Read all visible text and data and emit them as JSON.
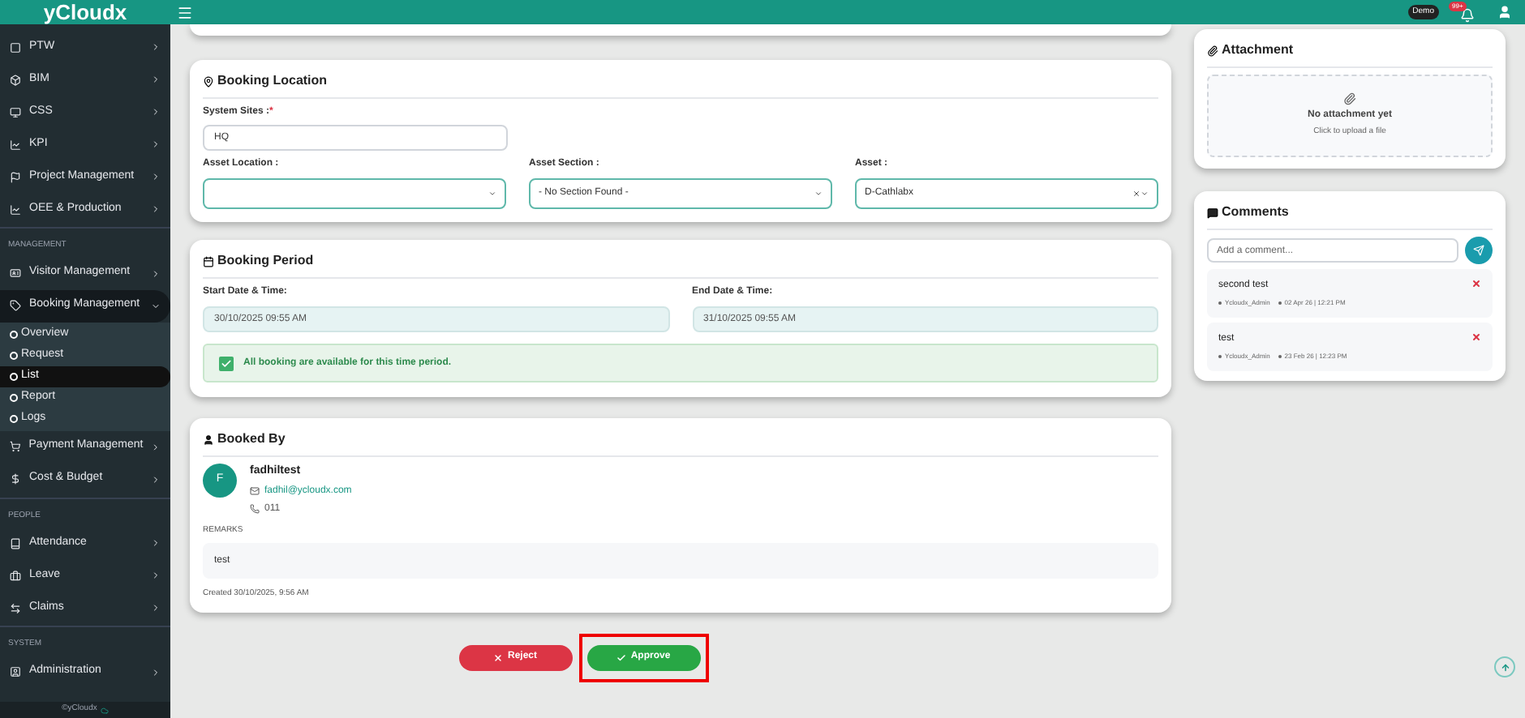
{
  "brand": "yCloudx",
  "topbar": {
    "badge": "Demo",
    "notifications": "99+"
  },
  "sidebar": {
    "entries": [
      {
        "kind": "item",
        "label": "PTW",
        "expanded": false
      },
      {
        "kind": "item",
        "label": "BIM",
        "expanded": false
      },
      {
        "kind": "item",
        "label": "CSS",
        "expanded": false
      },
      {
        "kind": "item",
        "label": "KPI",
        "expanded": false
      },
      {
        "kind": "item",
        "label": "Project Management",
        "expanded": false
      },
      {
        "kind": "item",
        "label": "OEE & Production",
        "expanded": false
      },
      {
        "kind": "header",
        "label": "MANAGEMENT"
      },
      {
        "kind": "item",
        "label": "Visitor Management",
        "expanded": false
      },
      {
        "kind": "item",
        "label": "Booking Management",
        "expanded": true,
        "children": [
          {
            "label": "Overview",
            "selected": false
          },
          {
            "label": "Request",
            "selected": false
          },
          {
            "label": "List",
            "selected": true
          },
          {
            "label": "Report",
            "selected": false
          },
          {
            "label": "Logs",
            "selected": false
          }
        ]
      },
      {
        "kind": "item",
        "label": "Payment Management",
        "expanded": false
      },
      {
        "kind": "item",
        "label": "Cost & Budget",
        "expanded": false
      },
      {
        "kind": "header",
        "label": "PEOPLE"
      },
      {
        "kind": "item",
        "label": "Attendance",
        "expanded": false
      },
      {
        "kind": "item",
        "label": "Leave",
        "expanded": false
      },
      {
        "kind": "item",
        "label": "Claims",
        "expanded": false
      },
      {
        "kind": "header",
        "label": "SYSTEM"
      },
      {
        "kind": "item",
        "label": "Administration",
        "expanded": false
      }
    ],
    "footer": "©yCloudx"
  },
  "booking_location": {
    "title": "Booking Location",
    "system_sites_label": "System Sites :",
    "required_mark": "*",
    "system_sites_value": "HQ",
    "selects": [
      {
        "label": "Asset Location :",
        "clearable": false
      },
      {
        "label": "Asset Section :",
        "value": "- No Section Found -",
        "clearable": false
      },
      {
        "label": "Asset :",
        "value": "D-Cathlabx",
        "clearable": true
      }
    ]
  },
  "booking_period": {
    "title": "Booking Period",
    "fields": [
      {
        "label": "Start Date & Time:",
        "value": "30/10/2025 09:55 AM"
      },
      {
        "label": "End Date & Time:",
        "value": "31/10/2025 09:55 AM"
      }
    ],
    "availability": {
      "checked": true,
      "message": "All booking are available for this time period."
    }
  },
  "booked_by": {
    "title": "Booked By",
    "initial": "F",
    "name": "fadhiltest",
    "email": "fadhil@ycloudx.com",
    "phone": "011",
    "remarks_label": "REMARKS",
    "remarks": "test",
    "created": "Created 30/10/2025, 9:56 AM"
  },
  "actions": [
    {
      "kind": "reject",
      "label": "Reject",
      "highlighted": false
    },
    {
      "kind": "approve",
      "label": "Approve",
      "highlighted": true
    }
  ],
  "attachment": {
    "title": "Attachment",
    "empty_text": "No attachment yet",
    "hint": "Click to upload a file"
  },
  "comments": {
    "title": "Comments",
    "placeholder": "Add a comment...",
    "items": [
      {
        "text": "second test",
        "author": "Ycloudx_Admin",
        "time": "02 Apr 26 | 12:21 PM"
      },
      {
        "text": "test",
        "author": "Ycloudx_Admin",
        "time": "23 Feb 26 | 12:23 PM"
      }
    ]
  }
}
